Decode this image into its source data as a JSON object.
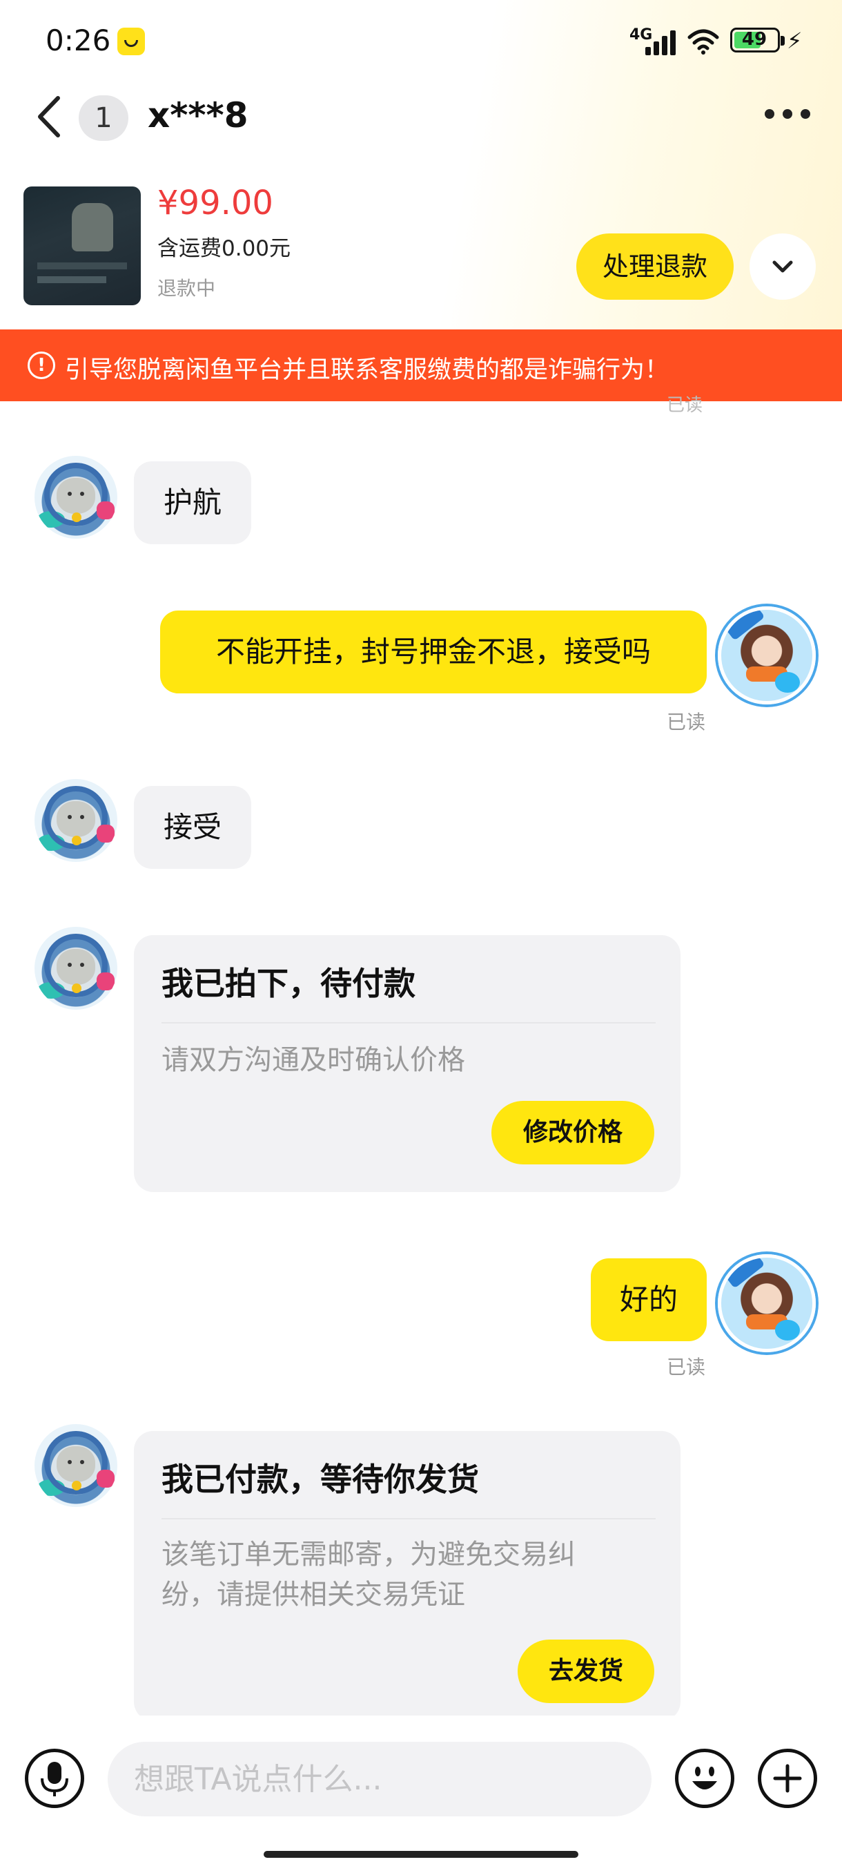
{
  "status_bar": {
    "time": "0:26",
    "network": "4G",
    "battery": "49",
    "app_icon": "xianyu-app-icon"
  },
  "nav": {
    "unread_count": "1",
    "title": "x***8"
  },
  "product": {
    "price": "¥99.00",
    "shipping": "含运费0.00元",
    "status": "退款中",
    "action_label": "处理退款"
  },
  "warning": {
    "text": "引导您脱离闲鱼平台并且联系客服缴费的都是诈骗行为！"
  },
  "messages": {
    "faded_read": "已读",
    "m1": "护航",
    "m2": "不能开挂，封号押金不退，接受吗",
    "m2_read": "已读",
    "m3": "接受",
    "card1": {
      "title": "我已拍下，待付款",
      "desc": "请双方沟通及时确认价格",
      "button": "修改价格"
    },
    "m4": "好的",
    "m4_read": "已读",
    "card2": {
      "title": "我已付款，等待你发货",
      "desc_line1": "该笔订单无需邮寄，为避免交易纠",
      "desc_line2": "纷，请提供相关交易凭证",
      "button": "去发货"
    }
  },
  "input": {
    "placeholder": "想跟TA说点什么..."
  },
  "colors": {
    "accent_yellow": "#ffe60f",
    "warning_orange": "#ff4f21",
    "price_red": "#ee3c3c",
    "bubble_gray": "#f2f2f4"
  }
}
